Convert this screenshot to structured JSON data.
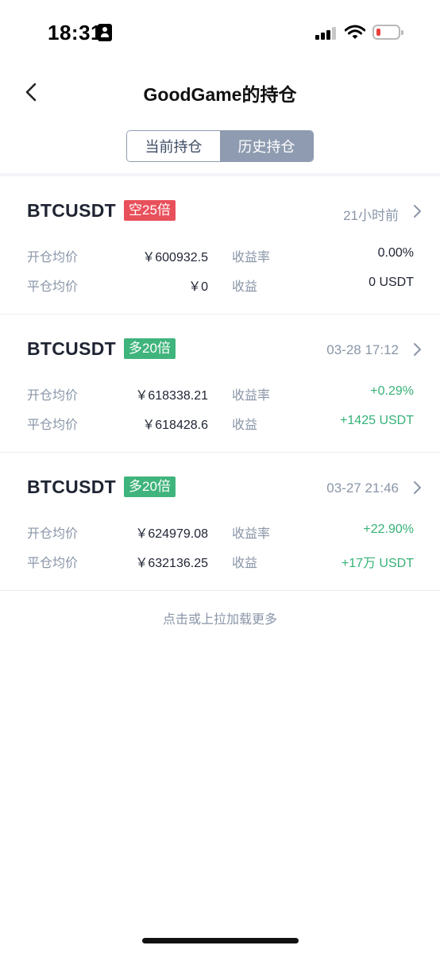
{
  "status_bar": {
    "time": "18:31"
  },
  "header": {
    "title": "GoodGame的持仓"
  },
  "tabs": [
    {
      "label": "当前持仓",
      "active": false
    },
    {
      "label": "历史持仓",
      "active": true
    }
  ],
  "field_labels": {
    "open_avg": "开仓均价",
    "close_avg": "平仓均价",
    "return_rate": "收益率",
    "profit": "收益"
  },
  "positions": [
    {
      "symbol": "BTCUSDT",
      "badge": "空25倍",
      "badge_color": "#e8505b",
      "time": "21小时前",
      "open_avg": "￥600932.5",
      "close_avg": "￥0",
      "return_rate": "0.00%",
      "profit": "0 USDT",
      "value_color": "#1f2433"
    },
    {
      "symbol": "BTCUSDT",
      "badge": "多20倍",
      "badge_color": "#3fb47c",
      "time": "03-28 17:12",
      "open_avg": "￥618338.21",
      "close_avg": "￥618428.6",
      "return_rate": "+0.29%",
      "profit": "+1425 USDT",
      "value_color": "#35b277"
    },
    {
      "symbol": "BTCUSDT",
      "badge": "多20倍",
      "badge_color": "#3fb47c",
      "time": "03-27 21:46",
      "open_avg": "￥624979.08",
      "close_avg": "￥632136.25",
      "return_rate": "+22.90%",
      "profit": "+17万 USDT",
      "value_color": "#35b277"
    }
  ],
  "load_more": "点击或上拉加载更多"
}
